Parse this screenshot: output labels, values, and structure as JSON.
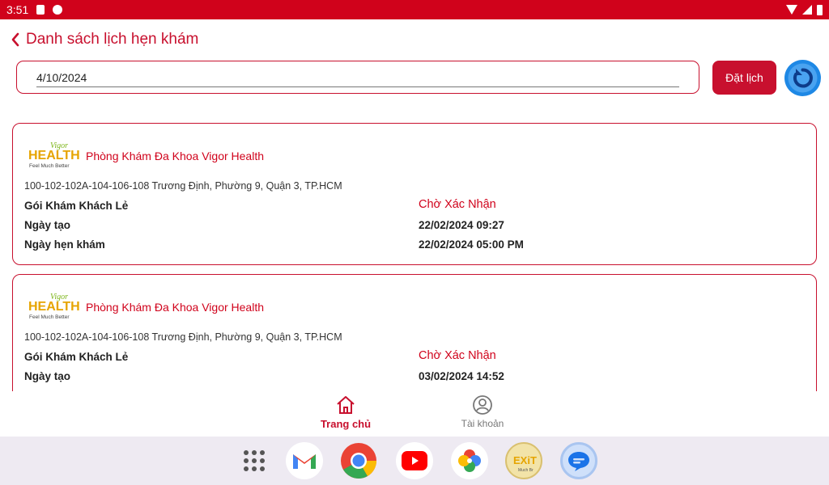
{
  "status_bar": {
    "time": "3:51"
  },
  "header": {
    "title": "Danh sách lịch hẹn khám"
  },
  "search": {
    "date_value": "4/10/2024"
  },
  "actions": {
    "book_label": "Đặt lịch"
  },
  "appointments": [
    {
      "clinic_name": "Phòng Khám Đa Khoa Vigor Health",
      "address": "100-102-102A-104-106-108 Trương Định, Phường 9, Quận 3, TP.HCM",
      "package": "Gói Khám Khách Lẻ",
      "status": "Chờ Xác Nhận",
      "created_label": "Ngày tạo",
      "created_value": "22/02/2024 09:27",
      "appointment_label": "Ngày hẹn khám",
      "appointment_value": "22/02/2024 05:00 PM"
    },
    {
      "clinic_name": "Phòng Khám Đa Khoa Vigor Health",
      "address": "100-102-102A-104-106-108 Trương Định, Phường 9, Quận 3, TP.HCM",
      "package": "Gói Khám Khách Lẻ",
      "status": "Chờ Xác Nhận",
      "created_label": "Ngày tạo",
      "created_value": "03/02/2024 14:52"
    }
  ],
  "logo": {
    "brand_top": "Vigor",
    "brand_main": "HEALTH",
    "tagline": "Feel Much Better"
  },
  "bottom_nav": {
    "home_label": "Trang chủ",
    "account_label": "Tài khoản"
  },
  "dock": {
    "apps": [
      "apps-grid-icon",
      "gmail-icon",
      "chrome-icon",
      "youtube-icon",
      "photos-icon",
      "exit-app-icon",
      "messages-icon"
    ]
  },
  "colors": {
    "primary": "#c8102e",
    "status_bar": "#d0021b",
    "refresh": "#1e88e5"
  }
}
